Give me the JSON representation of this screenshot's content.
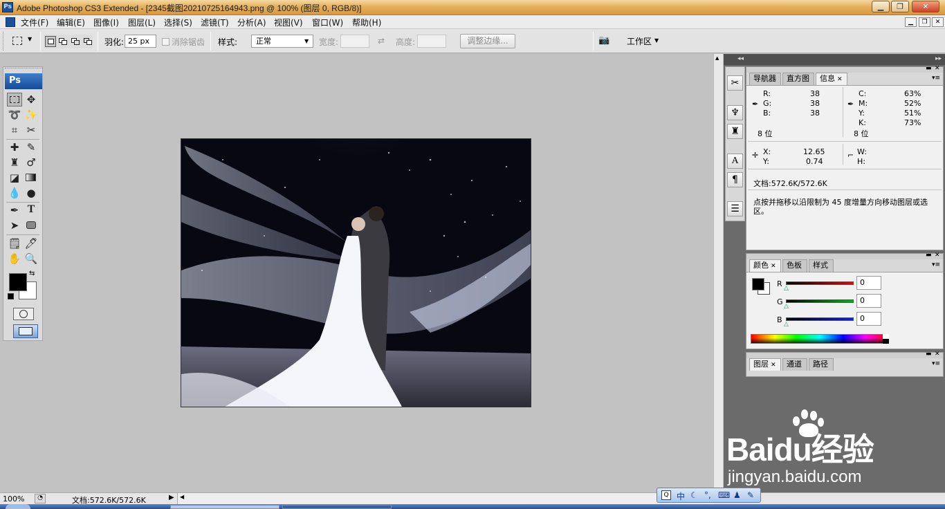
{
  "window": {
    "title": "Adobe Photoshop CS3 Extended - [2345截图20210725164943.png @ 100% (图层 0, RGB/8)]",
    "controls": [
      "▁",
      "❐",
      "✕"
    ]
  },
  "menu": [
    "文件(F)",
    "编辑(E)",
    "图像(I)",
    "图层(L)",
    "选择(S)",
    "滤镜(T)",
    "分析(A)",
    "视图(V)",
    "窗口(W)",
    "帮助(H)"
  ],
  "doc_controls": [
    "▁",
    "❐",
    "✕"
  ],
  "options": {
    "feather_label": "羽化:",
    "feather_value": "25 px",
    "antialias_label": "消除锯齿",
    "style_label": "样式:",
    "style_value": "正常",
    "width_label": "宽度:",
    "height_label": "高度:",
    "refine_button": "调整边缘...",
    "workspace_label": "工作区"
  },
  "toolbox": {
    "logo": "Ps"
  },
  "info_panel": {
    "tabs": [
      "导航器",
      "直方图",
      "信息"
    ],
    "active_tab": "信息",
    "rgb": {
      "r_label": "R:",
      "g_label": "G:",
      "b_label": "B:",
      "r": "38",
      "g": "38",
      "b": "38",
      "bits": "8 位"
    },
    "cmyk": {
      "c_label": "C:",
      "m_label": "M:",
      "y_label": "Y:",
      "k_label": "K:",
      "c": "63%",
      "m": "52%",
      "y": "51%",
      "k": "73%",
      "bits": "8 位"
    },
    "xy": {
      "x_label": "X:",
      "y_label": "Y:",
      "x": "12.65",
      "y": "0.74"
    },
    "wh": {
      "w_label": "W:",
      "h_label": "H:"
    },
    "doc_size": "文档:572.6K/572.6K",
    "hint": "点按并拖移以沿限制为 45 度增量方向移动图层或选区。"
  },
  "color_panel": {
    "tabs": [
      "颜色",
      "色板",
      "样式"
    ],
    "active_tab": "颜色",
    "channels": [
      {
        "label": "R",
        "value": "0",
        "color": "#cc1111"
      },
      {
        "label": "G",
        "value": "0",
        "color": "#11aa22"
      },
      {
        "label": "B",
        "value": "0",
        "color": "#1122cc"
      }
    ],
    "foreground": "#000000",
    "background": "#ffffff"
  },
  "layers_panel": {
    "tabs": [
      "图层",
      "通道",
      "路径"
    ],
    "active_tab": "图层"
  },
  "status": {
    "zoom": "100%",
    "doc": "文档:572.6K/572.6K"
  },
  "ime": {
    "mode": "中"
  },
  "watermark": {
    "brand": "Baidu经验",
    "url": "jingyan.baidu.com"
  }
}
